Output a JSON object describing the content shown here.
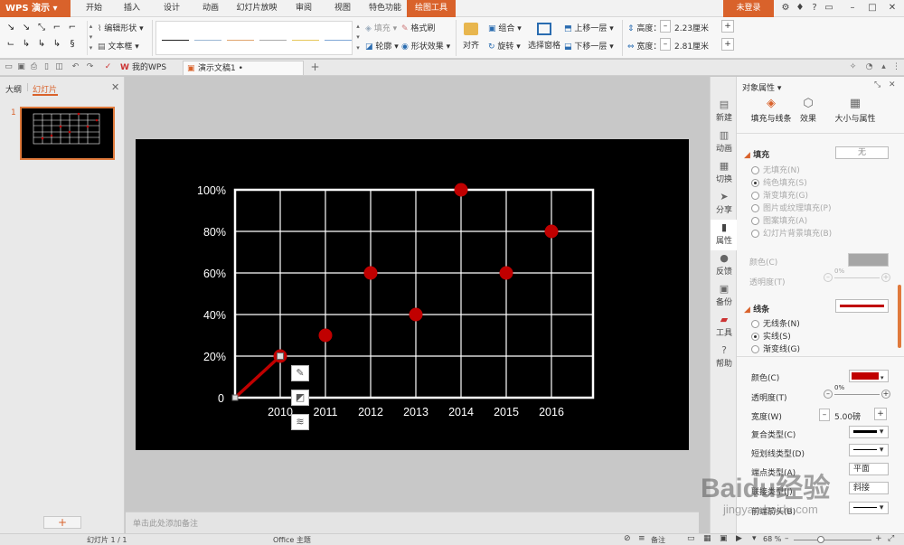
{
  "app": {
    "name": "WPS 演示",
    "login": "未登录"
  },
  "menu": [
    "开始",
    "插入",
    "设计",
    "动画",
    "幻灯片放映",
    "审阅",
    "视图",
    "特色功能",
    "绘图工具"
  ],
  "ribbon": {
    "edit_shape": "编辑形状",
    "textbox": "文本框",
    "fill": "填充",
    "format_brush": "格式刷",
    "outline": "轮廓",
    "shape_effects": "形状效果",
    "align": "对齐",
    "group": "组合",
    "rotate": "旋转",
    "select_pane": "选择窗格",
    "bring_forward": "上移一层",
    "send_backward": "下移一层",
    "height_label": "高度：",
    "height_value": "2.23厘米",
    "width_label": "宽度：",
    "width_value": "2.81厘米",
    "colors": {
      "accent": "#d9622b",
      "line_red": "#c00000"
    }
  },
  "tabs": {
    "my_wps": "我的WPS",
    "doc": "演示文稿1 •"
  },
  "left_panel": {
    "tab_outline": "大纲",
    "tab_slides": "幻灯片",
    "slide_number": "1",
    "add_button": "+"
  },
  "chart_data": {
    "type": "line",
    "categories": [
      "2010",
      "2011",
      "2012",
      "2013",
      "2014",
      "2015",
      "2016"
    ],
    "series": [
      {
        "values": [
          20,
          30,
          60,
          40,
          100,
          60,
          80
        ]
      }
    ],
    "y_ticks": [
      "0",
      "20%",
      "40%",
      "60%",
      "80%",
      "100%"
    ],
    "ylim": [
      0,
      100
    ],
    "grid": true,
    "point_color": "#c00000",
    "background": "#000000"
  },
  "notes": {
    "placeholder": "单击此处添加备注"
  },
  "sidebar": [
    "新建",
    "动画",
    "切换",
    "分享",
    "属性",
    "反馈",
    "备份",
    "工具",
    "帮助"
  ],
  "props": {
    "title": "对象属性",
    "tab_fill_line": "填充与线条",
    "tab_effects": "效果",
    "tab_size": "大小与属性",
    "fill_header": "填充",
    "fill_none_btn": "无",
    "fill_options": [
      "无填充(N)",
      "纯色填充(S)",
      "渐变填充(G)",
      "图片或纹理填充(P)",
      "图案填充(A)",
      "幻灯片背景填充(B)"
    ],
    "color_label": "颜色(C)",
    "transparency_label": "透明度(T)",
    "fill_transparency": "0%",
    "line_header": "线条",
    "line_options": [
      "无线条(N)",
      "实线(S)",
      "渐变线(G)"
    ],
    "line_color_label": "颜色(C)",
    "line_transparency_label": "透明度(T)",
    "line_transparency": "0%",
    "width_label": "宽度(W)",
    "width_value": "5.00磅",
    "compound_label": "复合类型(C)",
    "dash_label": "短划线类型(D)",
    "cap_label": "端点类型(A)",
    "cap_value": "平面",
    "join_label": "联接类型(J)",
    "join_value": "斜接",
    "arrow_label": "前端箭头(B)"
  },
  "status": {
    "slide_info": "幻灯片 1 / 1",
    "theme": "Office 主题",
    "notes": "备注",
    "zoom": "68 %"
  },
  "watermark": {
    "main": "Baidu经验",
    "sub": "jingyan.baidu.com"
  }
}
